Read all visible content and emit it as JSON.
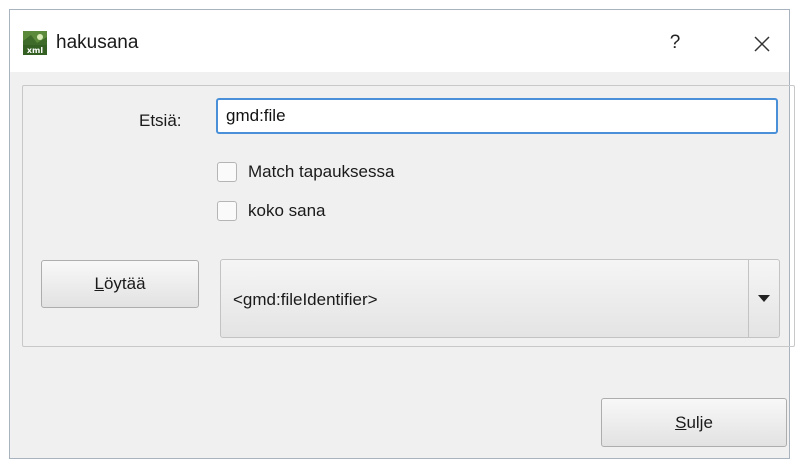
{
  "window": {
    "title": "hakusana",
    "help_label": "?",
    "icon": "xml-file-icon",
    "close_icon": "close-icon"
  },
  "search": {
    "label": "Etsiä:",
    "value": "gmd:file"
  },
  "options": {
    "match_case_label": "Match tapauksessa",
    "match_case_checked": false,
    "whole_word_label": "koko sana",
    "whole_word_checked": false
  },
  "find_button": {
    "mnemonic": "L",
    "rest": "öytää"
  },
  "results": {
    "selected": "<gmd:fileIdentifier>",
    "dropdown_icon": "chevron-down-icon"
  },
  "close_button": {
    "mnemonic": "S",
    "rest": "ulje"
  },
  "colors": {
    "focus_border": "#4a90d9",
    "dialog_background": "#f0f0f0",
    "titlebar_background": "#ffffff"
  }
}
